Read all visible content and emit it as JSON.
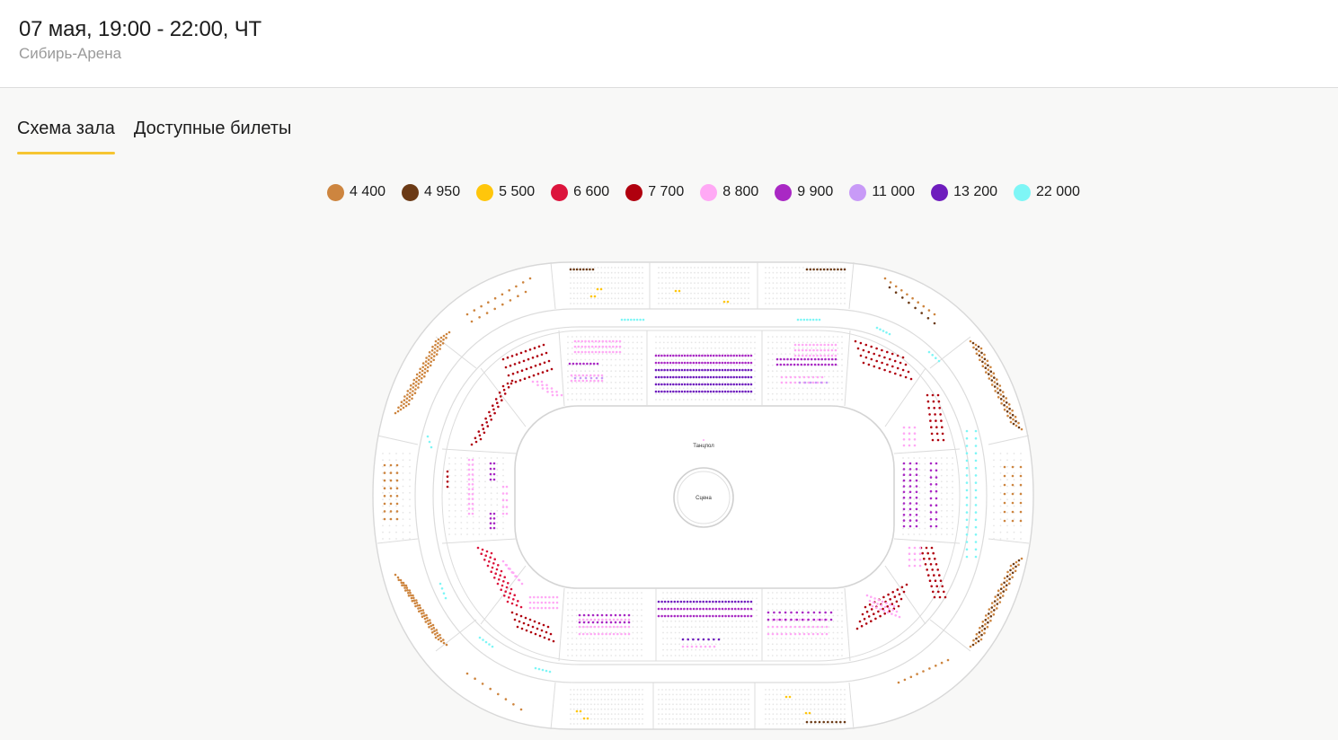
{
  "header": {
    "title": "07 мая, 19:00 - 22:00, ЧТ",
    "venue": "Сибирь-Арена"
  },
  "tabs": [
    {
      "label": "Схема зала",
      "active": true
    },
    {
      "label": "Доступные билеты",
      "active": false
    }
  ],
  "legend": [
    {
      "price": "4 400",
      "color": "#cd853f"
    },
    {
      "price": "4 950",
      "color": "#6b3a16"
    },
    {
      "price": "5 500",
      "color": "#ffc60b"
    },
    {
      "price": "6 600",
      "color": "#dc143c"
    },
    {
      "price": "7 700",
      "color": "#b0000e"
    },
    {
      "price": "8 800",
      "color": "#ffa9f5"
    },
    {
      "price": "9 900",
      "color": "#a928c4"
    },
    {
      "price": "11 000",
      "color": "#c89af7"
    },
    {
      "price": "13 200",
      "color": "#6e1cbd"
    },
    {
      "price": "22 000",
      "color": "#7ef6f6"
    }
  ],
  "map": {
    "dance_floor_label": "Танцпол",
    "stage_label": "Сцена"
  }
}
